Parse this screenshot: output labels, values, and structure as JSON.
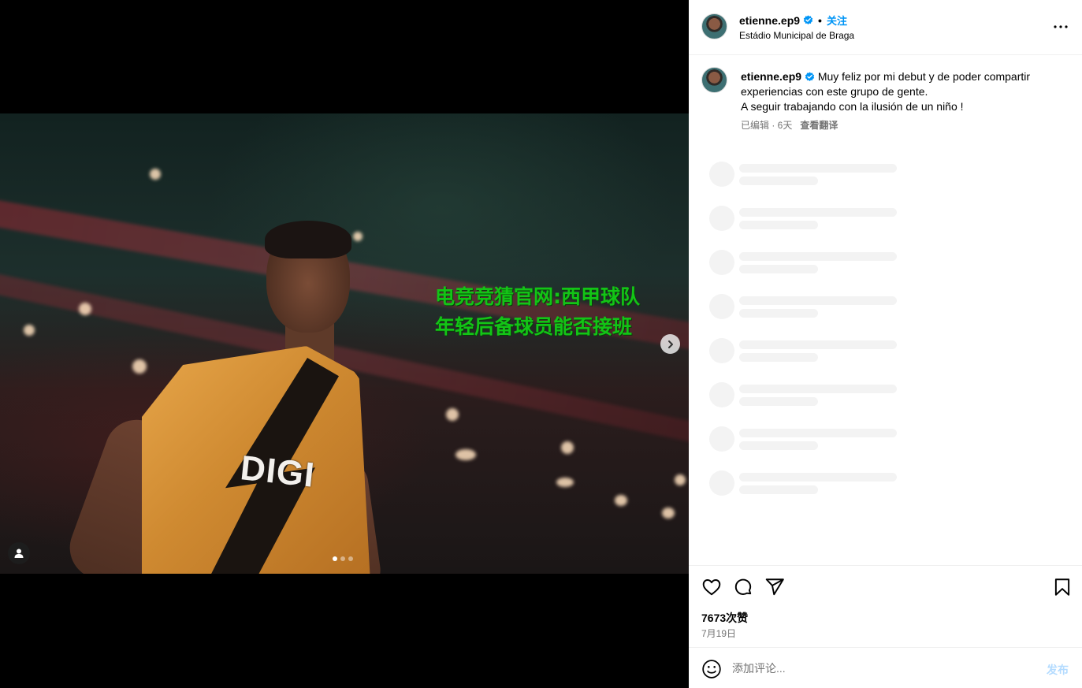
{
  "post": {
    "username": "etienne.ep9",
    "location": "Estádio Municipal de Braga",
    "follow_label": "关注",
    "separator": "•",
    "caption_line1": "Muy feliz por mi debut y de poder compartir experiencias con este grupo de gente.",
    "caption_line2": "A seguir trabajando con la ilusión de un niño !",
    "edited_time": "已编辑 · 6天",
    "translate_label": "查看翻译",
    "likes": "7673次赞",
    "date": "7月19日"
  },
  "media": {
    "overlay_text": "电竞竞猜官网:西甲球队年轻后备球员能否接班",
    "jersey_sponsor": "DIGI",
    "slide_count": 3,
    "active_slide": 1
  },
  "comment_box": {
    "placeholder": "添加评论...",
    "post_label": "发布"
  },
  "icons": {
    "next": "chevron-right-icon",
    "tag": "user-tag-icon",
    "more": "more-horizontal-icon",
    "like": "heart-icon",
    "comment": "comment-icon",
    "share": "send-icon",
    "save": "bookmark-icon",
    "emoji": "emoji-icon",
    "verified": "verified-badge-icon"
  },
  "colors": {
    "accent": "#0095f6",
    "overlay_text": "#13c416",
    "muted": "#737373"
  }
}
